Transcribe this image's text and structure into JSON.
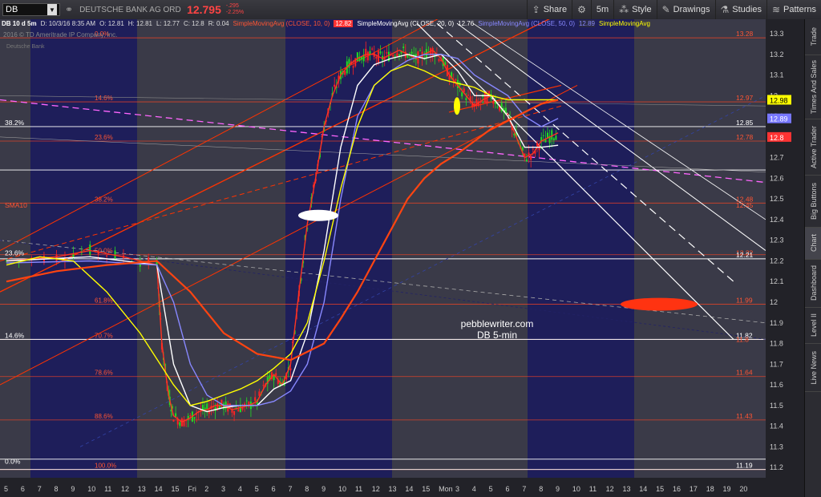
{
  "toolbar": {
    "symbol": "DB",
    "company": "DEUTSCHE BANK AG ORD",
    "last": "12.795",
    "change": "-.295",
    "change_pct": "-2.25%",
    "share": "Share",
    "interval": "5m",
    "style": "Style",
    "drawings": "Drawings",
    "studies": "Studies",
    "patterns": "Patterns"
  },
  "info": {
    "title": "DB 10 d 5m",
    "date": "D: 10/3/16 8:35 AM",
    "open": "O: 12.81",
    "high": "H: 12.81",
    "low": "L: 12.77",
    "close": "C: 12.8",
    "range": "R: 0.04",
    "sma10": "SimpleMovingAvg (CLOSE, 10, 0)",
    "sma10v": "12.82",
    "sma20": "SimpleMovingAvg (CLOSE, 20, 0)",
    "sma20v": "12.76",
    "sma50": "SimpleMovingAvg (CLOSE, 50, 0)",
    "sma50v": "12.89",
    "sma200": "SimpleMovingAvg"
  },
  "copyright": "2016 © TD Ameritrade IP Company, Inc.",
  "watermark": "Deutsche Bank",
  "sidebar": [
    "Trade",
    "Times And Sales",
    "Active Trader",
    "Big Buttons",
    "Chart",
    "Dashboard",
    "Level II",
    "Live News"
  ],
  "chart_data": {
    "type": "line",
    "ylim": [
      11.15,
      13.37
    ],
    "yticks": [
      "13.3",
      "13.2",
      "13.1",
      "13",
      "12.9",
      "12.8",
      "12.7",
      "12.6",
      "12.5",
      "12.4",
      "12.3",
      "12.2",
      "12.1",
      "12",
      "11.9",
      "11.8",
      "11.7",
      "11.6",
      "11.5",
      "11.4",
      "11.3",
      "11.2"
    ],
    "xticks": [
      "5",
      "6",
      "7",
      "8",
      "9",
      "10",
      "11",
      "12",
      "13",
      "14",
      "15",
      "Fri",
      "2",
      "3",
      "4",
      "5",
      "6",
      "7",
      "8",
      "9",
      "10",
      "11",
      "12",
      "13",
      "14",
      "15",
      "Mon",
      "3",
      "4",
      "5",
      "6",
      "7",
      "8",
      "9",
      "10",
      "11",
      "12",
      "13",
      "14",
      "15",
      "16",
      "17",
      "18",
      "19",
      "20"
    ],
    "price_tags": [
      {
        "label": "12.98",
        "value": 12.98,
        "bg": "#ffff00",
        "fg": "#000000"
      },
      {
        "label": "12.89",
        "value": 12.89,
        "bg": "#7777ff",
        "fg": "#ffffff"
      },
      {
        "label": "12.8",
        "value": 12.8,
        "bg": "#ff3333",
        "fg": "#ffffff"
      }
    ],
    "fib_levels": [
      {
        "label": "0.0%",
        "value": 13.28
      },
      {
        "label": "14.6%",
        "value": 12.97
      },
      {
        "label": "23.6%",
        "value": 12.78
      },
      {
        "label": "38.2%",
        "value": 12.48
      },
      {
        "label": "50.0%",
        "value": 12.23
      },
      {
        "label": "61.8%",
        "value": 11.99
      },
      {
        "label": "70.7%",
        "value": 11.82
      },
      {
        "label": "78.6%",
        "value": 11.64
      },
      {
        "label": "88.6%",
        "value": 11.43
      },
      {
        "label": "100.0%",
        "value": 11.19
      }
    ],
    "right_labels": [
      {
        "label": "13.28",
        "value": 13.28,
        "color": "#ff5533"
      },
      {
        "label": "12.97",
        "value": 12.97,
        "color": "#ff5533"
      },
      {
        "label": "12.85",
        "value": 12.85,
        "color": "#ffffff"
      },
      {
        "label": "12.78",
        "value": 12.78,
        "color": "#ff5533"
      },
      {
        "label": "12.48",
        "value": 12.48,
        "color": "#ff5533"
      },
      {
        "label": "12.45",
        "value": 12.45,
        "color": "#ff5533"
      },
      {
        "label": "12.22",
        "value": 12.22,
        "color": "#ff5533"
      },
      {
        "label": "12.21",
        "value": 12.21,
        "color": "#ffffff"
      },
      {
        "label": "11.99",
        "value": 11.99,
        "color": "#ff5533"
      },
      {
        "label": "11.82",
        "value": 11.82,
        "color": "#ffffff"
      },
      {
        "label": "11.8",
        "value": 11.8,
        "color": "#ff5533"
      },
      {
        "label": "11.64",
        "value": 11.64,
        "color": "#ff5533"
      },
      {
        "label": "11.43",
        "value": 11.43,
        "color": "#ff5533"
      },
      {
        "label": "11.19",
        "value": 11.19,
        "color": "#ffffff"
      }
    ],
    "left_labels": [
      {
        "label": "38.2%",
        "value": 12.85,
        "color": "#ffffff"
      },
      {
        "label": "SMA10",
        "value": 12.45,
        "color": "#ff5533"
      },
      {
        "label": "23.6%",
        "value": 12.22,
        "color": "#ffffff"
      },
      {
        "label": "14.6%",
        "value": 11.82,
        "color": "#ffffff"
      },
      {
        "label": "0.0%",
        "value": 11.21,
        "color": "#ffffff"
      }
    ],
    "annotation": [
      "pebblewriter.com",
      "DB 5-min"
    ],
    "series": [
      {
        "name": "SMA10",
        "color": "#ff3322",
        "x": [
          0,
          3,
          5,
          7,
          9,
          9.3,
          9.7,
          10,
          10.5,
          11,
          11.5,
          12,
          12.5,
          13,
          13.5,
          14,
          14.5,
          15,
          15.5,
          16,
          16.5,
          17,
          17.5,
          18,
          18.5,
          19,
          19.5,
          20,
          20.5,
          21,
          21.5,
          22,
          22.5,
          23,
          23.5,
          24,
          24.5,
          25,
          25.5,
          26,
          26.5,
          27,
          27.5,
          28,
          28.5,
          29,
          29.5,
          30,
          30.5,
          31,
          31.5,
          32,
          32.5,
          33
        ],
        "y": [
          12.2,
          12.22,
          12.25,
          12.22,
          12.18,
          11.8,
          11.55,
          11.45,
          11.42,
          11.44,
          11.47,
          11.48,
          11.5,
          11.5,
          11.48,
          11.49,
          11.5,
          11.52,
          11.6,
          11.65,
          11.6,
          11.7,
          12.05,
          12.38,
          12.6,
          12.85,
          13.0,
          13.1,
          13.15,
          13.18,
          13.2,
          13.2,
          13.18,
          13.2,
          13.22,
          13.2,
          13.18,
          13.2,
          13.22,
          13.18,
          13.1,
          13.05,
          13.0,
          12.95,
          12.98,
          13.0,
          12.95,
          12.9,
          12.8,
          12.7,
          12.72,
          12.78,
          12.8,
          12.82
        ]
      },
      {
        "name": "SMA20",
        "color": "#ffffff",
        "x": [
          0,
          5,
          9,
          10,
          11,
          12,
          13,
          14,
          15,
          16,
          17,
          18,
          19,
          20,
          21,
          22,
          23,
          24,
          25,
          26,
          27,
          28,
          29,
          30,
          31,
          32,
          33
        ],
        "y": [
          12.2,
          12.22,
          12.18,
          11.7,
          11.5,
          11.47,
          11.49,
          11.5,
          11.5,
          11.58,
          11.62,
          11.85,
          12.25,
          12.75,
          13.05,
          13.15,
          13.18,
          13.2,
          13.18,
          13.2,
          13.12,
          13.0,
          13.0,
          12.9,
          12.75,
          12.75,
          12.76
        ]
      },
      {
        "name": "SMA50",
        "color": "#8888ff",
        "x": [
          0,
          5,
          9,
          10,
          11,
          12,
          13,
          14,
          15,
          16,
          17,
          18,
          19,
          20,
          21,
          22,
          23,
          24,
          25,
          26,
          27,
          28,
          29,
          30,
          31,
          32,
          33
        ],
        "y": [
          12.19,
          12.2,
          12.18,
          12.0,
          11.7,
          11.55,
          11.5,
          11.5,
          11.5,
          11.52,
          11.57,
          11.7,
          12.0,
          12.5,
          12.9,
          13.05,
          13.12,
          13.17,
          13.2,
          13.2,
          13.18,
          13.1,
          13.05,
          13.0,
          12.9,
          12.85,
          12.89
        ]
      },
      {
        "name": "SMA_yellow",
        "color": "#ffff00",
        "x": [
          0,
          2,
          4,
          6,
          8,
          10,
          11,
          12,
          13,
          14,
          15,
          16,
          17,
          18,
          19,
          20,
          21,
          22,
          23,
          24,
          25,
          26,
          27,
          28,
          29,
          30,
          31,
          32,
          33
        ],
        "y": [
          12.18,
          12.22,
          12.2,
          12.05,
          11.85,
          11.6,
          11.5,
          11.52,
          11.55,
          11.58,
          11.62,
          11.68,
          11.75,
          11.9,
          12.2,
          12.55,
          12.85,
          13.05,
          13.12,
          13.15,
          13.12,
          13.08,
          13.06,
          13.04,
          13.0,
          12.98,
          12.98,
          12.98,
          12.98
        ]
      },
      {
        "name": "SMA_orange",
        "color": "#ff4411",
        "x": [
          0,
          3,
          6,
          9,
          11,
          13,
          15,
          17,
          19,
          20,
          21,
          22,
          23,
          24,
          25,
          26,
          27,
          28,
          29,
          30,
          31,
          32,
          33
        ],
        "y": [
          12.1,
          12.15,
          12.18,
          12.2,
          12.05,
          11.85,
          11.75,
          11.72,
          11.8,
          11.92,
          12.05,
          12.2,
          12.35,
          12.5,
          12.6,
          12.67,
          12.72,
          12.78,
          12.84,
          12.88,
          12.92,
          12.96,
          12.98
        ]
      }
    ]
  }
}
